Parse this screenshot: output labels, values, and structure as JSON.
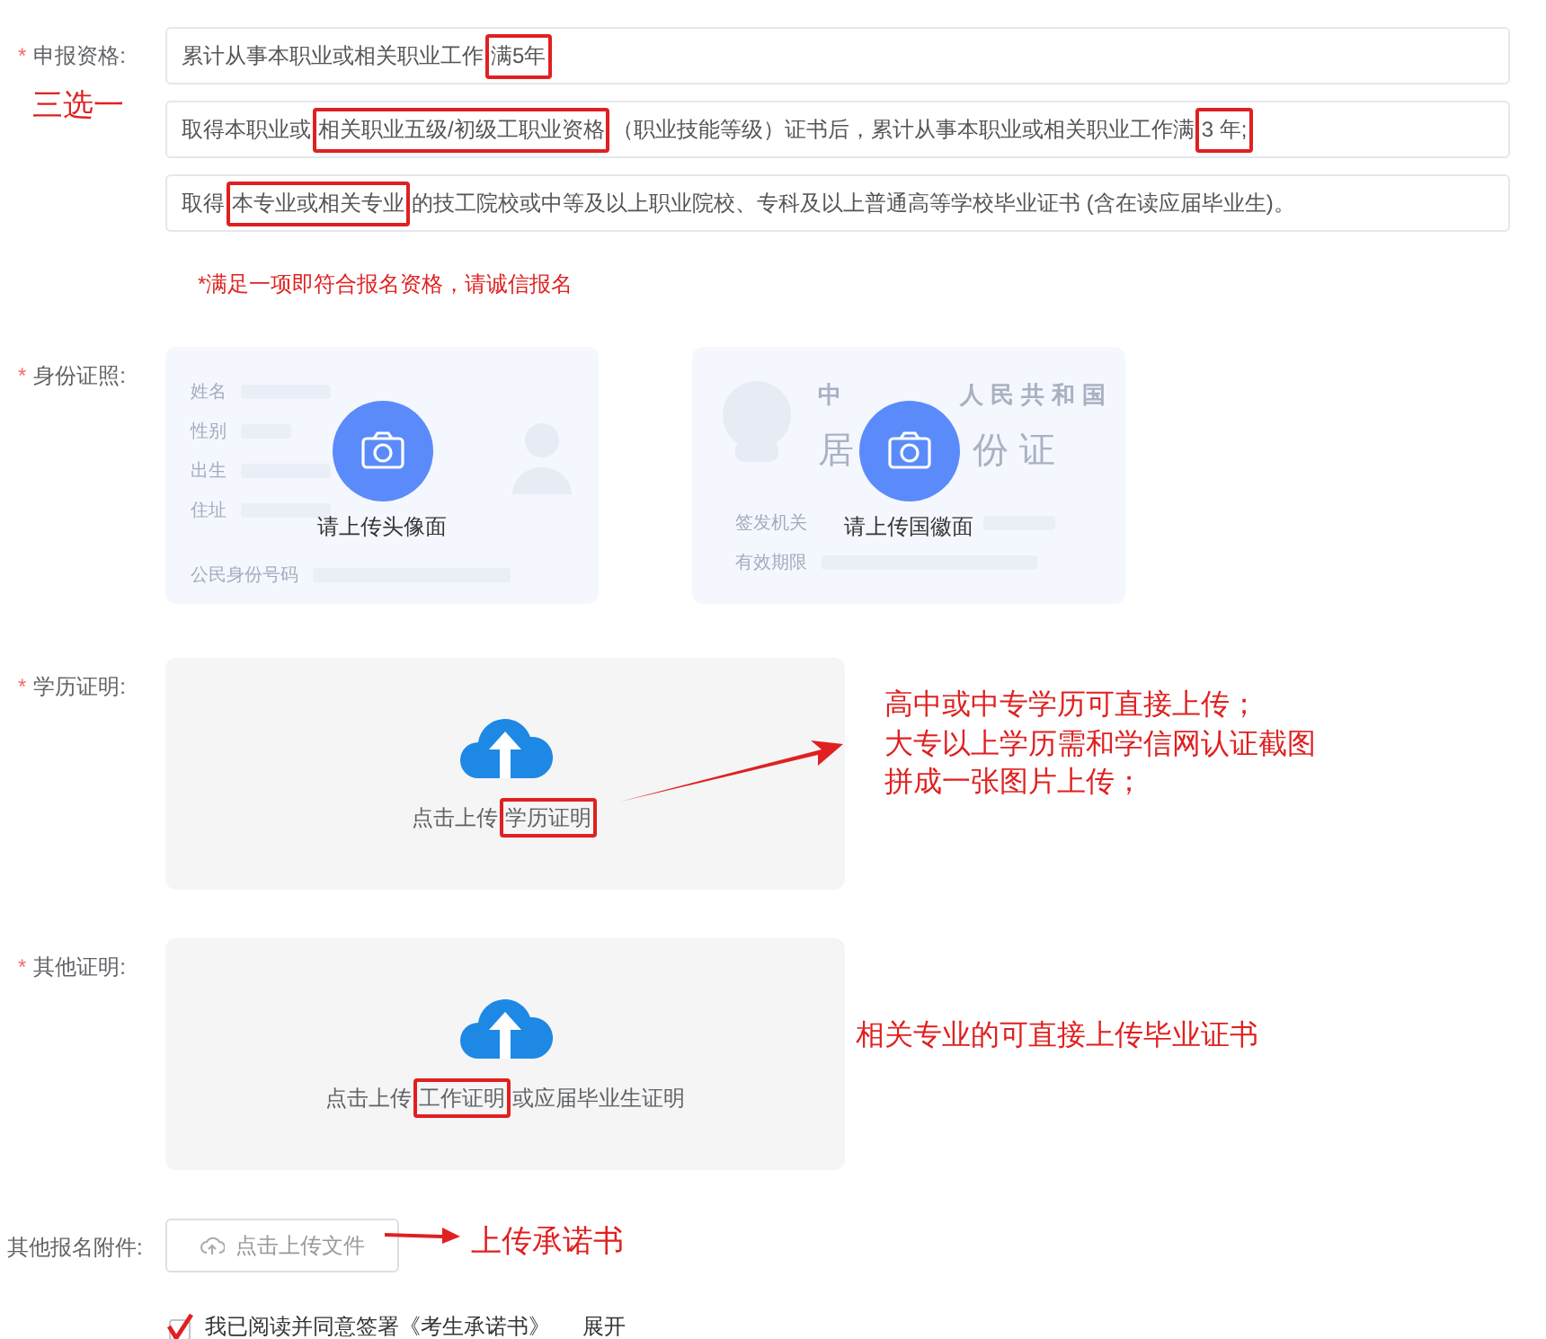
{
  "fields": [
    {
      "kind": "options",
      "label": "申报资格:",
      "marker": "*",
      "options": [
        [
          {
            "text": "累计从事本职业或相关职业工作",
            "boxed": false
          },
          {
            "text": "满5年",
            "boxed": true
          }
        ],
        [
          {
            "text": "取得本职业或",
            "boxed": false
          },
          {
            "text": "相关职业五级/初级工职业资格",
            "boxed": true
          },
          {
            "text": "（职业技能等级）证书后，累计从事本职业或相关职业工作满",
            "boxed": false
          },
          {
            "text": " 3 年;",
            "boxed": true
          }
        ],
        [
          {
            "text": "取得",
            "boxed": false
          },
          {
            "text": "本专业或相关专业",
            "boxed": true
          },
          {
            "text": "的技工院校或中等及以上职业院校、专科及以上普通高等学校毕业证书 (含在读应届毕业生)。",
            "boxed": false
          }
        ]
      ],
      "note": "*满足一项即符合报名资格，请诚信报名"
    },
    {
      "kind": "id_cards",
      "label": "身份证照:",
      "marker": "*",
      "cards": [
        {
          "kind": "portrait",
          "caption": "请上传头像面",
          "rows": [
            "姓名",
            "性别",
            "出生",
            "住址"
          ],
          "footer": "公民身份号码"
        },
        {
          "kind": "emblem",
          "caption": "请上传国徽面",
          "title": [
            "中",
            "人民共和国"
          ],
          "subtitle": [
            "居",
            "份证"
          ],
          "rows": [
            "签发机关",
            "有效期限"
          ]
        }
      ]
    },
    {
      "kind": "upload",
      "label": "学历证明:",
      "marker": "*",
      "hint": [
        {
          "text": "点击上传",
          "boxed": false
        },
        {
          "text": "学历证明",
          "boxed": true
        }
      ]
    },
    {
      "kind": "upload",
      "label": "其他证明:",
      "marker": "*",
      "hint": [
        {
          "text": "点击上传",
          "boxed": false
        },
        {
          "text": "工作证明",
          "boxed": true
        },
        {
          "text": "或应届毕业生证明",
          "boxed": false
        }
      ]
    },
    {
      "kind": "file_button",
      "label": "其他报名附件:",
      "button": "点击上传文件"
    }
  ],
  "agreement": {
    "checked": true,
    "text": "我已阅读并同意签署《考生承诺书》",
    "link": "展开"
  },
  "annotations": [
    {
      "lines": [
        "三选一"
      ]
    },
    {
      "lines": [
        "高中或中专学历可直接上传；",
        "大专以上学历需和学信网认证截图",
        "拼成一张图片上传；"
      ]
    },
    {
      "lines": [
        "相关专业的可直接上传毕业证书"
      ]
    },
    {
      "lines": [
        "上传承诺书"
      ]
    }
  ]
}
